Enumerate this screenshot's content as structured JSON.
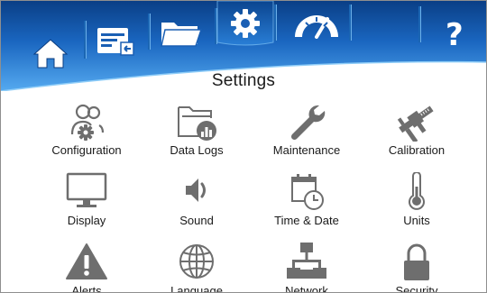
{
  "page": {
    "title": "Settings"
  },
  "nav": {
    "items": [
      {
        "id": "home",
        "icon": "home-icon"
      },
      {
        "id": "screen-logs",
        "icon": "screen-export-icon"
      },
      {
        "id": "files",
        "icon": "folder-icon"
      },
      {
        "id": "settings",
        "icon": "gear-icon",
        "active": true
      },
      {
        "id": "gauge",
        "icon": "gauge-icon"
      },
      {
        "id": "help",
        "icon": "question-icon",
        "label": "?"
      }
    ]
  },
  "tiles": [
    {
      "label": "Configuration",
      "icon": "users-gear-icon"
    },
    {
      "label": "Data Logs",
      "icon": "folder-chart-icon"
    },
    {
      "label": "Maintenance",
      "icon": "wrench-icon"
    },
    {
      "label": "Calibration",
      "icon": "caliper-icon"
    },
    {
      "label": "Display",
      "icon": "monitor-icon"
    },
    {
      "label": "Sound",
      "icon": "speaker-icon"
    },
    {
      "label": "Time & Date",
      "icon": "calendar-clock-icon"
    },
    {
      "label": "Units",
      "icon": "thermometer-icon"
    },
    {
      "label": "Alerts",
      "icon": "warning-icon"
    },
    {
      "label": "Language",
      "icon": "globe-icon"
    },
    {
      "label": "Network",
      "icon": "network-icon"
    },
    {
      "label": "Security",
      "icon": "lock-icon"
    }
  ],
  "colors": {
    "header_top": "#0a3f86",
    "header_mid": "#1f74cf",
    "header_glow": "#55aaf0",
    "icon_fill": "#ffffff",
    "tile_icon": "#6e6e6e"
  }
}
